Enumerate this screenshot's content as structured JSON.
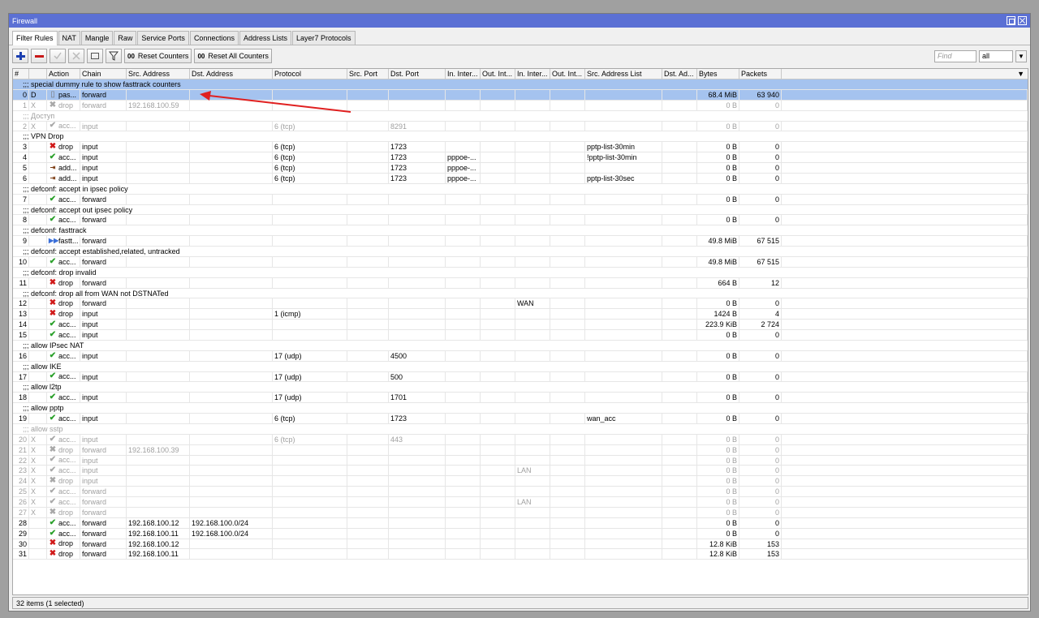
{
  "window": {
    "title": "Firewall"
  },
  "tabs": [
    "Filter Rules",
    "NAT",
    "Mangle",
    "Raw",
    "Service Ports",
    "Connections",
    "Address Lists",
    "Layer7 Protocols"
  ],
  "toolbar": {
    "reset_counters": "Reset Counters",
    "reset_all_counters": "Reset All Counters",
    "counter_icon": "00",
    "find_placeholder": "Find",
    "filter_select": "all"
  },
  "columns": [
    "#",
    "",
    "Action",
    "Chain",
    "Src. Address",
    "Dst. Address",
    "Protocol",
    "Src. Port",
    "Dst. Port",
    "In. Inter...",
    "Out. Int...",
    "In. Inter...",
    "Out. Int...",
    "Src. Address List",
    "Dst. Ad...",
    "Bytes",
    "Packets"
  ],
  "rows": [
    {
      "type": "comment",
      "text": ";;; special dummy rule to show fasttrack counters",
      "selected": true
    },
    {
      "type": "rule",
      "num": "0",
      "flag": "D",
      "icon": "pass",
      "action": "pas...",
      "chain": "forward",
      "src": "",
      "dst": "",
      "proto": "",
      "sport": "",
      "dport": "",
      "inif": "",
      "outif": "",
      "inif2": "",
      "outif2": "",
      "srclist": "",
      "dstad": "",
      "bytes": "68.4 MiB",
      "packets": "63 940",
      "selected": true
    },
    {
      "type": "rule",
      "num": "1",
      "flag": "X",
      "icon": "drop",
      "action": "drop",
      "chain": "forward",
      "src": "192.168.100.59",
      "dst": "",
      "proto": "",
      "sport": "",
      "dport": "",
      "inif": "",
      "outif": "",
      "inif2": "",
      "outif2": "",
      "srclist": "",
      "dstad": "",
      "bytes": "0 B",
      "packets": "0",
      "disabled": true
    },
    {
      "type": "comment",
      "text": ";;; Доступ",
      "disabled": true
    },
    {
      "type": "rule",
      "num": "2",
      "flag": "X",
      "icon": "accept",
      "action": "acc...",
      "chain": "input",
      "src": "",
      "dst": "",
      "proto": "6 (tcp)",
      "sport": "",
      "dport": "8291",
      "inif": "",
      "outif": "",
      "inif2": "",
      "outif2": "",
      "srclist": "",
      "dstad": "",
      "bytes": "0 B",
      "packets": "0",
      "disabled": true
    },
    {
      "type": "comment",
      "text": ";;; VPN Drop"
    },
    {
      "type": "rule",
      "num": "3",
      "flag": "",
      "icon": "drop",
      "action": "drop",
      "chain": "input",
      "src": "",
      "dst": "",
      "proto": "6 (tcp)",
      "sport": "",
      "dport": "1723",
      "inif": "",
      "outif": "",
      "inif2": "",
      "outif2": "",
      "srclist": "pptp-list-30min",
      "dstad": "",
      "bytes": "0 B",
      "packets": "0"
    },
    {
      "type": "rule",
      "num": "4",
      "flag": "",
      "icon": "accept",
      "action": "acc...",
      "chain": "input",
      "src": "",
      "dst": "",
      "proto": "6 (tcp)",
      "sport": "",
      "dport": "1723",
      "inif": "pppoe-...",
      "outif": "",
      "inif2": "",
      "outif2": "",
      "srclist": "!pptp-list-30min",
      "dstad": "",
      "bytes": "0 B",
      "packets": "0"
    },
    {
      "type": "rule",
      "num": "5",
      "flag": "",
      "icon": "add",
      "action": "add...",
      "chain": "input",
      "src": "",
      "dst": "",
      "proto": "6 (tcp)",
      "sport": "",
      "dport": "1723",
      "inif": "pppoe-...",
      "outif": "",
      "inif2": "",
      "outif2": "",
      "srclist": "",
      "dstad": "",
      "bytes": "0 B",
      "packets": "0"
    },
    {
      "type": "rule",
      "num": "6",
      "flag": "",
      "icon": "add",
      "action": "add...",
      "chain": "input",
      "src": "",
      "dst": "",
      "proto": "6 (tcp)",
      "sport": "",
      "dport": "1723",
      "inif": "pppoe-...",
      "outif": "",
      "inif2": "",
      "outif2": "",
      "srclist": "pptp-list-30sec",
      "dstad": "",
      "bytes": "0 B",
      "packets": "0"
    },
    {
      "type": "comment",
      "text": ";;; defconf: accept in ipsec policy"
    },
    {
      "type": "rule",
      "num": "7",
      "flag": "",
      "icon": "accept",
      "action": "acc...",
      "chain": "forward",
      "src": "",
      "dst": "",
      "proto": "",
      "sport": "",
      "dport": "",
      "inif": "",
      "outif": "",
      "inif2": "",
      "outif2": "",
      "srclist": "",
      "dstad": "",
      "bytes": "0 B",
      "packets": "0"
    },
    {
      "type": "comment",
      "text": ";;; defconf: accept out ipsec policy"
    },
    {
      "type": "rule",
      "num": "8",
      "flag": "",
      "icon": "accept",
      "action": "acc...",
      "chain": "forward",
      "src": "",
      "dst": "",
      "proto": "",
      "sport": "",
      "dport": "",
      "inif": "",
      "outif": "",
      "inif2": "",
      "outif2": "",
      "srclist": "",
      "dstad": "",
      "bytes": "0 B",
      "packets": "0"
    },
    {
      "type": "comment",
      "text": ";;; defconf: fasttrack"
    },
    {
      "type": "rule",
      "num": "9",
      "flag": "",
      "icon": "fast",
      "action": "fastt...",
      "chain": "forward",
      "src": "",
      "dst": "",
      "proto": "",
      "sport": "",
      "dport": "",
      "inif": "",
      "outif": "",
      "inif2": "",
      "outif2": "",
      "srclist": "",
      "dstad": "",
      "bytes": "49.8 MiB",
      "packets": "67 515"
    },
    {
      "type": "comment",
      "text": ";;; defconf: accept established,related, untracked"
    },
    {
      "type": "rule",
      "num": "10",
      "flag": "",
      "icon": "accept",
      "action": "acc...",
      "chain": "forward",
      "src": "",
      "dst": "",
      "proto": "",
      "sport": "",
      "dport": "",
      "inif": "",
      "outif": "",
      "inif2": "",
      "outif2": "",
      "srclist": "",
      "dstad": "",
      "bytes": "49.8 MiB",
      "packets": "67 515"
    },
    {
      "type": "comment",
      "text": ";;; defconf: drop invalid"
    },
    {
      "type": "rule",
      "num": "11",
      "flag": "",
      "icon": "drop",
      "action": "drop",
      "chain": "forward",
      "src": "",
      "dst": "",
      "proto": "",
      "sport": "",
      "dport": "",
      "inif": "",
      "outif": "",
      "inif2": "",
      "outif2": "",
      "srclist": "",
      "dstad": "",
      "bytes": "664 B",
      "packets": "12"
    },
    {
      "type": "comment",
      "text": ";;; defconf:  drop all from WAN not DSTNATed"
    },
    {
      "type": "rule",
      "num": "12",
      "flag": "",
      "icon": "drop",
      "action": "drop",
      "chain": "forward",
      "src": "",
      "dst": "",
      "proto": "",
      "sport": "",
      "dport": "",
      "inif": "",
      "outif": "",
      "inif2": "WAN",
      "outif2": "",
      "srclist": "",
      "dstad": "",
      "bytes": "0 B",
      "packets": "0"
    },
    {
      "type": "rule",
      "num": "13",
      "flag": "",
      "icon": "drop",
      "action": "drop",
      "chain": "input",
      "src": "",
      "dst": "",
      "proto": "1 (icmp)",
      "sport": "",
      "dport": "",
      "inif": "",
      "outif": "",
      "inif2": "",
      "outif2": "",
      "srclist": "",
      "dstad": "",
      "bytes": "1424 B",
      "packets": "4"
    },
    {
      "type": "rule",
      "num": "14",
      "flag": "",
      "icon": "accept",
      "action": "acc...",
      "chain": "input",
      "src": "",
      "dst": "",
      "proto": "",
      "sport": "",
      "dport": "",
      "inif": "",
      "outif": "",
      "inif2": "",
      "outif2": "",
      "srclist": "",
      "dstad": "",
      "bytes": "223.9 KiB",
      "packets": "2 724"
    },
    {
      "type": "rule",
      "num": "15",
      "flag": "",
      "icon": "accept",
      "action": "acc...",
      "chain": "input",
      "src": "",
      "dst": "",
      "proto": "",
      "sport": "",
      "dport": "",
      "inif": "",
      "outif": "",
      "inif2": "",
      "outif2": "",
      "srclist": "",
      "dstad": "",
      "bytes": "0 B",
      "packets": "0"
    },
    {
      "type": "comment",
      "text": ";;; allow IPsec NAT"
    },
    {
      "type": "rule",
      "num": "16",
      "flag": "",
      "icon": "accept",
      "action": "acc...",
      "chain": "input",
      "src": "",
      "dst": "",
      "proto": "17 (udp)",
      "sport": "",
      "dport": "4500",
      "inif": "",
      "outif": "",
      "inif2": "",
      "outif2": "",
      "srclist": "",
      "dstad": "",
      "bytes": "0 B",
      "packets": "0"
    },
    {
      "type": "comment",
      "text": ";;; allow IKE"
    },
    {
      "type": "rule",
      "num": "17",
      "flag": "",
      "icon": "accept",
      "action": "acc...",
      "chain": "input",
      "src": "",
      "dst": "",
      "proto": "17 (udp)",
      "sport": "",
      "dport": "500",
      "inif": "",
      "outif": "",
      "inif2": "",
      "outif2": "",
      "srclist": "",
      "dstad": "",
      "bytes": "0 B",
      "packets": "0"
    },
    {
      "type": "comment",
      "text": ";;; allow l2tp"
    },
    {
      "type": "rule",
      "num": "18",
      "flag": "",
      "icon": "accept",
      "action": "acc...",
      "chain": "input",
      "src": "",
      "dst": "",
      "proto": "17 (udp)",
      "sport": "",
      "dport": "1701",
      "inif": "",
      "outif": "",
      "inif2": "",
      "outif2": "",
      "srclist": "",
      "dstad": "",
      "bytes": "0 B",
      "packets": "0"
    },
    {
      "type": "comment",
      "text": ";;; allow pptp"
    },
    {
      "type": "rule",
      "num": "19",
      "flag": "",
      "icon": "accept",
      "action": "acc...",
      "chain": "input",
      "src": "",
      "dst": "",
      "proto": "6 (tcp)",
      "sport": "",
      "dport": "1723",
      "inif": "",
      "outif": "",
      "inif2": "",
      "outif2": "",
      "srclist": "wan_acc",
      "dstad": "",
      "bytes": "0 B",
      "packets": "0"
    },
    {
      "type": "comment",
      "text": ";;; allow sstp",
      "disabled": true
    },
    {
      "type": "rule",
      "num": "20",
      "flag": "X",
      "icon": "accept",
      "action": "acc...",
      "chain": "input",
      "src": "",
      "dst": "",
      "proto": "6 (tcp)",
      "sport": "",
      "dport": "443",
      "inif": "",
      "outif": "",
      "inif2": "",
      "outif2": "",
      "srclist": "",
      "dstad": "",
      "bytes": "0 B",
      "packets": "0",
      "disabled": true
    },
    {
      "type": "rule",
      "num": "21",
      "flag": "X",
      "icon": "drop",
      "action": "drop",
      "chain": "forward",
      "src": "192.168.100.39",
      "dst": "",
      "proto": "",
      "sport": "",
      "dport": "",
      "inif": "",
      "outif": "",
      "inif2": "",
      "outif2": "",
      "srclist": "",
      "dstad": "",
      "bytes": "0 B",
      "packets": "0",
      "disabled": true
    },
    {
      "type": "rule",
      "num": "22",
      "flag": "X",
      "icon": "accept",
      "action": "acc...",
      "chain": "input",
      "src": "",
      "dst": "",
      "proto": "",
      "sport": "",
      "dport": "",
      "inif": "",
      "outif": "",
      "inif2": "",
      "outif2": "",
      "srclist": "",
      "dstad": "",
      "bytes": "0 B",
      "packets": "0",
      "disabled": true
    },
    {
      "type": "rule",
      "num": "23",
      "flag": "X",
      "icon": "accept",
      "action": "acc...",
      "chain": "input",
      "src": "",
      "dst": "",
      "proto": "",
      "sport": "",
      "dport": "",
      "inif": "",
      "outif": "",
      "inif2": "LAN",
      "outif2": "",
      "srclist": "",
      "dstad": "",
      "bytes": "0 B",
      "packets": "0",
      "disabled": true
    },
    {
      "type": "rule",
      "num": "24",
      "flag": "X",
      "icon": "drop",
      "action": "drop",
      "chain": "input",
      "src": "",
      "dst": "",
      "proto": "",
      "sport": "",
      "dport": "",
      "inif": "",
      "outif": "",
      "inif2": "",
      "outif2": "",
      "srclist": "",
      "dstad": "",
      "bytes": "0 B",
      "packets": "0",
      "disabled": true
    },
    {
      "type": "rule",
      "num": "25",
      "flag": "X",
      "icon": "accept",
      "action": "acc...",
      "chain": "forward",
      "src": "",
      "dst": "",
      "proto": "",
      "sport": "",
      "dport": "",
      "inif": "",
      "outif": "",
      "inif2": "",
      "outif2": "",
      "srclist": "",
      "dstad": "",
      "bytes": "0 B",
      "packets": "0",
      "disabled": true
    },
    {
      "type": "rule",
      "num": "26",
      "flag": "X",
      "icon": "accept",
      "action": "acc...",
      "chain": "forward",
      "src": "",
      "dst": "",
      "proto": "",
      "sport": "",
      "dport": "",
      "inif": "",
      "outif": "",
      "inif2": "LAN",
      "outif2": "",
      "srclist": "",
      "dstad": "",
      "bytes": "0 B",
      "packets": "0",
      "disabled": true
    },
    {
      "type": "rule",
      "num": "27",
      "flag": "X",
      "icon": "drop",
      "action": "drop",
      "chain": "forward",
      "src": "",
      "dst": "",
      "proto": "",
      "sport": "",
      "dport": "",
      "inif": "",
      "outif": "",
      "inif2": "",
      "outif2": "",
      "srclist": "",
      "dstad": "",
      "bytes": "0 B",
      "packets": "0",
      "disabled": true
    },
    {
      "type": "rule",
      "num": "28",
      "flag": "",
      "icon": "accept",
      "action": "acc...",
      "chain": "forward",
      "src": "192.168.100.12",
      "dst": "192.168.100.0/24",
      "proto": "",
      "sport": "",
      "dport": "",
      "inif": "",
      "outif": "",
      "inif2": "",
      "outif2": "",
      "srclist": "",
      "dstad": "",
      "bytes": "0 B",
      "packets": "0"
    },
    {
      "type": "rule",
      "num": "29",
      "flag": "",
      "icon": "accept",
      "action": "acc...",
      "chain": "forward",
      "src": "192.168.100.11",
      "dst": "192.168.100.0/24",
      "proto": "",
      "sport": "",
      "dport": "",
      "inif": "",
      "outif": "",
      "inif2": "",
      "outif2": "",
      "srclist": "",
      "dstad": "",
      "bytes": "0 B",
      "packets": "0"
    },
    {
      "type": "rule",
      "num": "30",
      "flag": "",
      "icon": "drop",
      "action": "drop",
      "chain": "forward",
      "src": "192.168.100.12",
      "dst": "",
      "proto": "",
      "sport": "",
      "dport": "",
      "inif": "",
      "outif": "",
      "inif2": "",
      "outif2": "",
      "srclist": "",
      "dstad": "",
      "bytes": "12.8 KiB",
      "packets": "153"
    },
    {
      "type": "rule",
      "num": "31",
      "flag": "",
      "icon": "drop",
      "action": "drop",
      "chain": "forward",
      "src": "192.168.100.11",
      "dst": "",
      "proto": "",
      "sport": "",
      "dport": "",
      "inif": "",
      "outif": "",
      "inif2": "",
      "outif2": "",
      "srclist": "",
      "dstad": "",
      "bytes": "12.8 KiB",
      "packets": "153"
    }
  ],
  "status": {
    "text": "32 items (1 selected)"
  },
  "colors": {
    "titlebar": "#5b70d4",
    "selected": "#a5c3ef",
    "accept": "#2aa02a",
    "drop": "#d01818",
    "annotation_arrow": "#e02020"
  },
  "icons": {
    "accept": "check-icon",
    "drop": "x-icon",
    "fast": "fasttrack-icon",
    "add": "add-to-list-icon",
    "pass": "passthrough-icon"
  }
}
